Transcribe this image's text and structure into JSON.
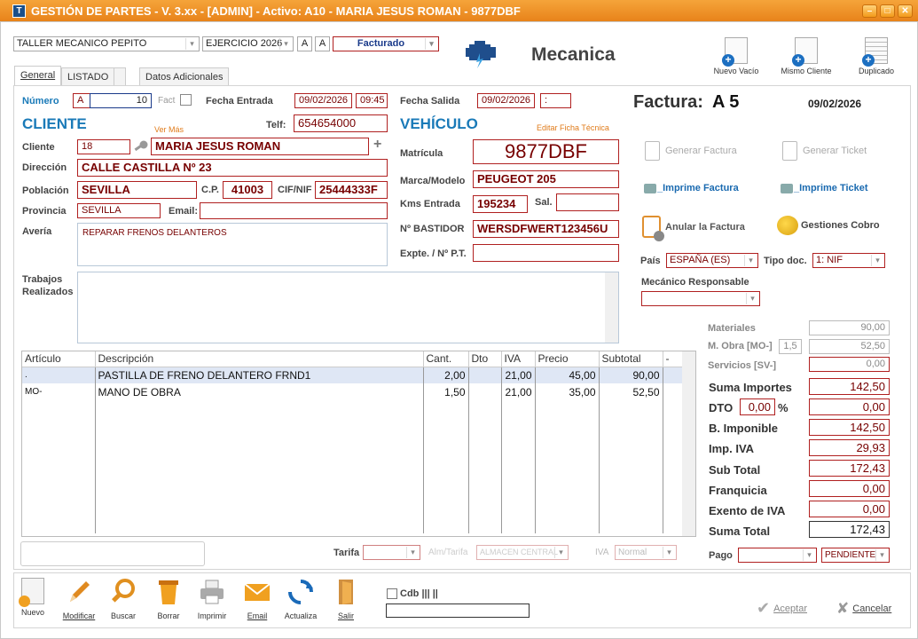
{
  "window": {
    "title": "GESTIÓN DE PARTES - V. 3.xx - [ADMIN] - Activo: A10 - MARIA JESUS ROMAN - 9877DBF"
  },
  "header": {
    "taller": "TALLER MECANICO PEPITO",
    "ejercicio": "EJERCICIO 2026",
    "a1": "A",
    "a2": "A",
    "estado": "Facturado",
    "module": "Mecanica",
    "btn_nuevo": "Nuevo Vacío",
    "btn_mismo": "Mismo Cliente",
    "btn_duplicado": "Duplicado"
  },
  "tabs": [
    "General",
    "LISTADO",
    "",
    "Datos Adicionales"
  ],
  "parte": {
    "numero_label": "Número",
    "serie": "A",
    "numero": "10",
    "fact_label": "Fact",
    "fecha_entrada_label": "Fecha Entrada",
    "fecha_entrada": "09/02/2026",
    "hora_entrada": "09:45",
    "fecha_salida_label": "Fecha Salida",
    "fecha_salida": "09/02/2026",
    "hora_salida": ":"
  },
  "cliente": {
    "heading": "CLIENTE",
    "ver_mas": "Ver Más",
    "telf_label": "Telf:",
    "telf": "654654000",
    "cliente_label": "Cliente",
    "codigo": "18",
    "nombre": "MARIA JESUS ROMAN",
    "direccion_label": "Dirección",
    "direccion": "CALLE CASTILLA Nº 23",
    "poblacion_label": "Población",
    "poblacion": "SEVILLA",
    "cp_label": "C.P.",
    "cp": "41003",
    "nif_label": "CIF/NIF",
    "nif": "25444333F",
    "provincia_label": "Provincia",
    "provincia": "SEVILLA",
    "email_label": "Email:",
    "email": "",
    "averia_label": "Avería",
    "averia": "REPARAR FRENOS DELANTEROS",
    "trabajos_label": "Trabajos Realizados",
    "trabajos": ""
  },
  "vehiculo": {
    "heading": "VEHÍCULO",
    "editar": "Editar Ficha Técnica",
    "matricula_label": "Matrícula",
    "matricula": "9877DBF",
    "marca_label": "Marca/Modelo",
    "marca": "PEUGEOT 205",
    "kms_label": "Kms Entrada",
    "kms": "195234",
    "sal_label": "Sal.",
    "sal": "",
    "bastidor_label": "Nº BASTIDOR",
    "bastidor": "WERSDFWERT123456U",
    "expte_label": "Expte. / Nº P.T.",
    "expte": ""
  },
  "factura": {
    "label": "Factura:",
    "numero": "A 5",
    "fecha": "09/02/2026",
    "generar_factura": "Generar Factura",
    "generar_ticket": "Generar Ticket",
    "imprime_factura": "_Imprime Factura",
    "imprime_ticket": "_Imprime Ticket",
    "anular": "Anular la Factura",
    "gestiones": "Gestiones Cobro",
    "pais_label": "País",
    "pais": "ESPAÑA (ES)",
    "tipodoc_label": "Tipo doc.",
    "tipodoc": "1: NIF",
    "mecanico_label": "Mecánico Responsable",
    "mecanico": ""
  },
  "lineas": {
    "columns": [
      "Artículo",
      "Descripción",
      "Cant.",
      "Dto",
      "IVA",
      "Precio",
      "Subtotal",
      "-"
    ],
    "rows": [
      {
        "articulo": ".",
        "descripcion": "PASTILLA DE FRENO DELANTERO FRND1",
        "cant": "2,00",
        "dto": "",
        "iva": "21,00",
        "precio": "45,00",
        "subtotal": "90,00"
      },
      {
        "articulo": "MO-",
        "descripcion": "MANO DE OBRA",
        "cant": "1,50",
        "dto": "",
        "iva": "21,00",
        "precio": "35,00",
        "subtotal": "52,50"
      }
    ]
  },
  "filtros": {
    "tarifa_label": "Tarifa",
    "tarifa": "",
    "almacen_label": "Alm/Tarifa",
    "almacen": "ALMACEN CENTRAL",
    "iva_label": "IVA",
    "iva": "Normal"
  },
  "totales": {
    "materiales_label": "Materiales",
    "materiales": "90,00",
    "mobra_label": "M. Obra [MO-]",
    "mobra_horas": "1,5",
    "mobra": "52,50",
    "servicios_label": "Servicios [SV-]",
    "servicios": "0,00",
    "suma_label": "Suma Importes",
    "suma": "142,50",
    "dto_label": "DTO",
    "dto_pct": "0,00",
    "dto_pct_sign": "%",
    "dto": "0,00",
    "base_label": "B. Imponible",
    "base": "142,50",
    "impiva_label": "Imp. IVA",
    "impiva": "29,93",
    "subtotal_label": "Sub Total",
    "subtotal": "172,43",
    "franquicia_label": "Franquicia",
    "franquicia": "0,00",
    "exento_label": "Exento de IVA",
    "exento": "0,00",
    "total_label": "Suma Total",
    "total": "172,43",
    "pago_label": "Pago",
    "pago": "",
    "pago_estado": "PENDIENTE"
  },
  "toolbar": {
    "nuevo": "Nuevo",
    "modificar": "Modificar",
    "buscar": "Buscar",
    "borrar": "Borrar",
    "imprimir": "Imprimir",
    "email": "Email",
    "actualiza": "Actualiza",
    "salir": "Salir",
    "cdb_label": "Cdb ||| ||",
    "aceptar": "Aceptar",
    "cancelar": "Cancelar"
  }
}
